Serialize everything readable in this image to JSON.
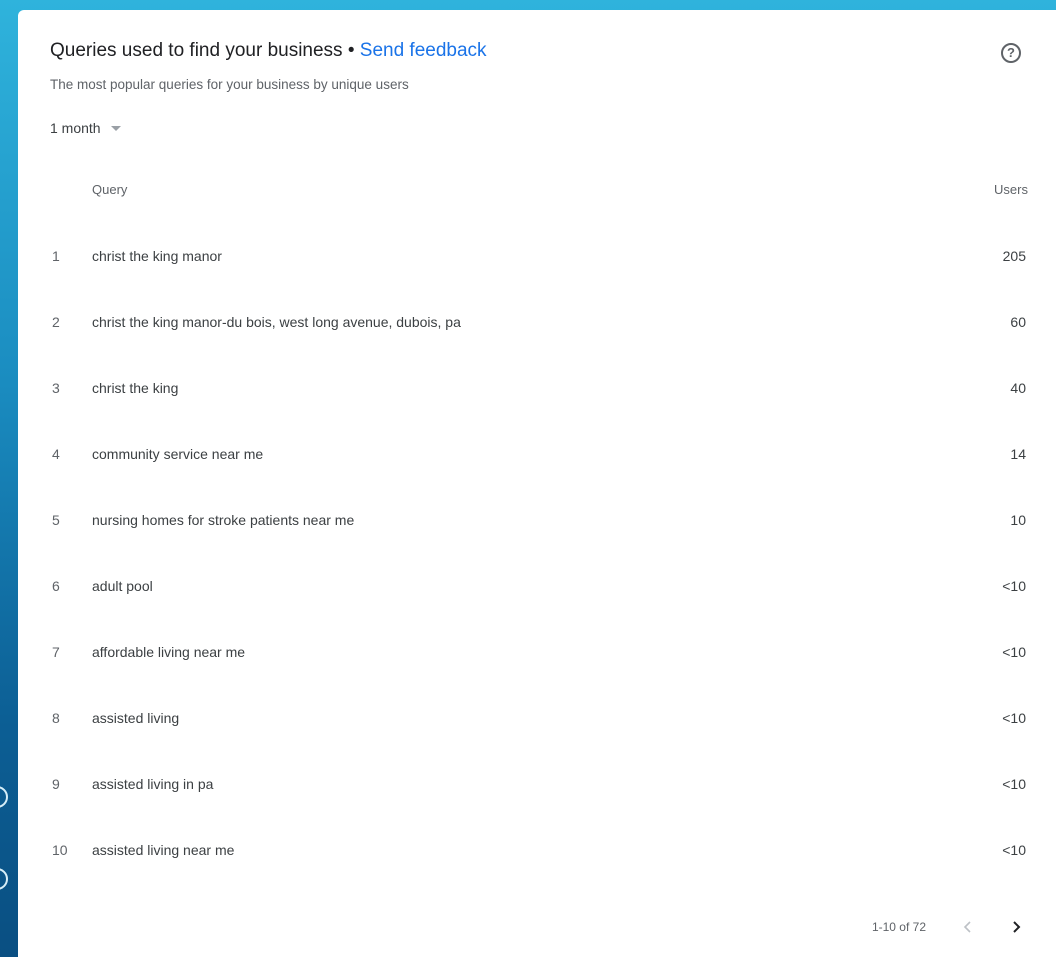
{
  "card": {
    "title": "Queries used to find your business",
    "separator": "•",
    "feedback_link": "Send feedback",
    "subtitle": "The most popular queries for your business by unique users",
    "period": "1 month",
    "help_icon": "help-circle-icon"
  },
  "table": {
    "headers": {
      "query": "Query",
      "users": "Users"
    },
    "rows": [
      {
        "rank": "1",
        "query": "christ the king manor",
        "users": "205"
      },
      {
        "rank": "2",
        "query": "christ the king manor-du bois, west long avenue, dubois, pa",
        "users": "60"
      },
      {
        "rank": "3",
        "query": "christ the king",
        "users": "40"
      },
      {
        "rank": "4",
        "query": "community service near me",
        "users": "14"
      },
      {
        "rank": "5",
        "query": "nursing homes for stroke patients near me",
        "users": "10"
      },
      {
        "rank": "6",
        "query": "adult pool",
        "users": "<10"
      },
      {
        "rank": "7",
        "query": "affordable living near me",
        "users": "<10"
      },
      {
        "rank": "8",
        "query": "assisted living",
        "users": "<10"
      },
      {
        "rank": "9",
        "query": "assisted living in pa",
        "users": "<10"
      },
      {
        "rank": "10",
        "query": "assisted living near me",
        "users": "<10"
      }
    ]
  },
  "pagination": {
    "range": "1-10 of 72",
    "prev_icon": "chevron-left-icon",
    "next_icon": "chevron-right-icon"
  },
  "colors": {
    "link": "#1a73e8",
    "text": "#202124",
    "muted": "#5f6368"
  }
}
